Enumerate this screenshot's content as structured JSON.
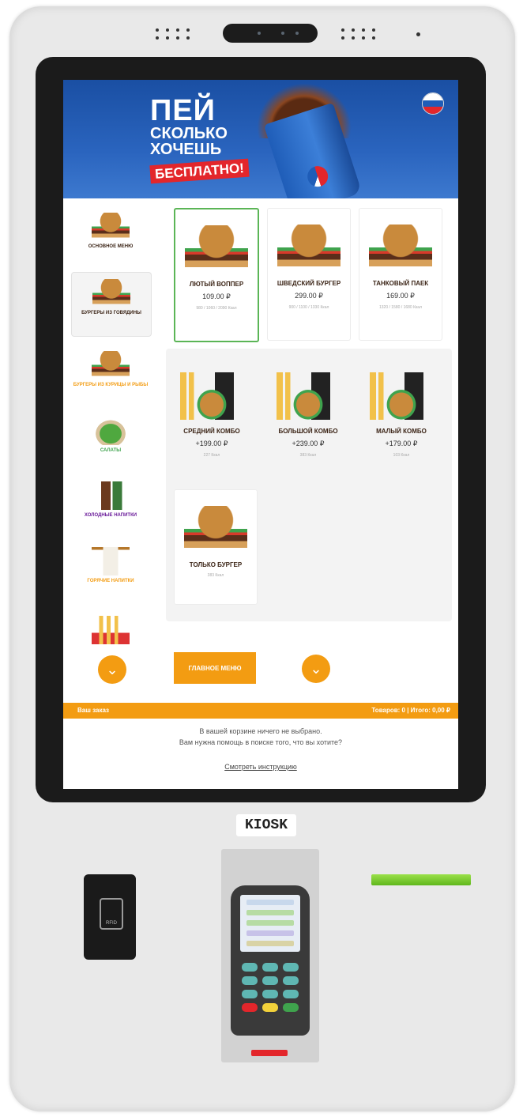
{
  "banner": {
    "line1": "ПЕЙ",
    "line2": "СКОЛЬКО",
    "line3": "ХОЧЕШЬ",
    "badge": "БЕСПЛАТНО!"
  },
  "sidebar": {
    "items": [
      {
        "label": "ОСНОВНОЕ МЕНЮ",
        "color": "#3b2416",
        "icon": "main-menu-icon"
      },
      {
        "label": "БУРГЕРЫ ИЗ ГОВЯДИНЫ",
        "color": "#3b2416",
        "icon": "beef-burger-icon"
      },
      {
        "label": "БУРГЕРЫ ИЗ КУРИЦЫ И РЫБЫ",
        "color": "#f39c12",
        "icon": "chicken-burger-icon"
      },
      {
        "label": "САЛАТЫ",
        "color": "#3fa34d",
        "icon": "salad-icon"
      },
      {
        "label": "ХОЛОДНЫЕ НАПИТКИ",
        "color": "#6a1b9a",
        "icon": "cold-drink-icon"
      },
      {
        "label": "ГОРЯЧИЕ НАПИТКИ",
        "color": "#f39c12",
        "icon": "hot-drink-icon"
      }
    ]
  },
  "products": [
    {
      "name": "ЛЮТЫЙ ВОППЕР",
      "price": "109.00 ₽",
      "kcal": "980 / 1060 / 2090 Ккал"
    },
    {
      "name": "ШВЕДСКИЙ БУРГЕР",
      "price": "299.00 ₽",
      "kcal": "900 / 1100 / 1330 Ккал"
    },
    {
      "name": "ТАНКОВЫЙ ПАЕК",
      "price": "169.00 ₽",
      "kcal": "1320 / 1580 / 1680 Ккал"
    }
  ],
  "combos": [
    {
      "name": "СРЕДНИЙ КОМБО",
      "price": "+199.00 ₽",
      "kcal": "227 Ккал"
    },
    {
      "name": "БОЛЬШОЙ КОМБО",
      "price": "+239.00 ₽",
      "kcal": "383 Ккал"
    },
    {
      "name": "МАЛЫЙ КОМБО",
      "price": "+179.00 ₽",
      "kcal": "103 Ккал"
    },
    {
      "name": "ТОЛЬКО БУРГЕР",
      "kcal": "383 Ккал"
    }
  ],
  "buttons": {
    "main_menu": "ГЛАВНОЕ МЕНЮ",
    "scroll_down": "⌄"
  },
  "order": {
    "label": "Ваш заказ",
    "summary": "Товаров: 0  |  Итого: 0,00 ₽",
    "empty_line1": "В вашей корзине ничего не выбрано.",
    "empty_line2": "Вам нужна помощь в поиске того, что вы хотите?",
    "guide_link": "Смотреть инструкцию"
  },
  "hardware": {
    "brand": "KIOSK",
    "rfid_label": "RFID"
  },
  "colors": {
    "accent": "#f39c12",
    "selected_border": "#5bb556",
    "banner_blue": "#2a64be"
  }
}
